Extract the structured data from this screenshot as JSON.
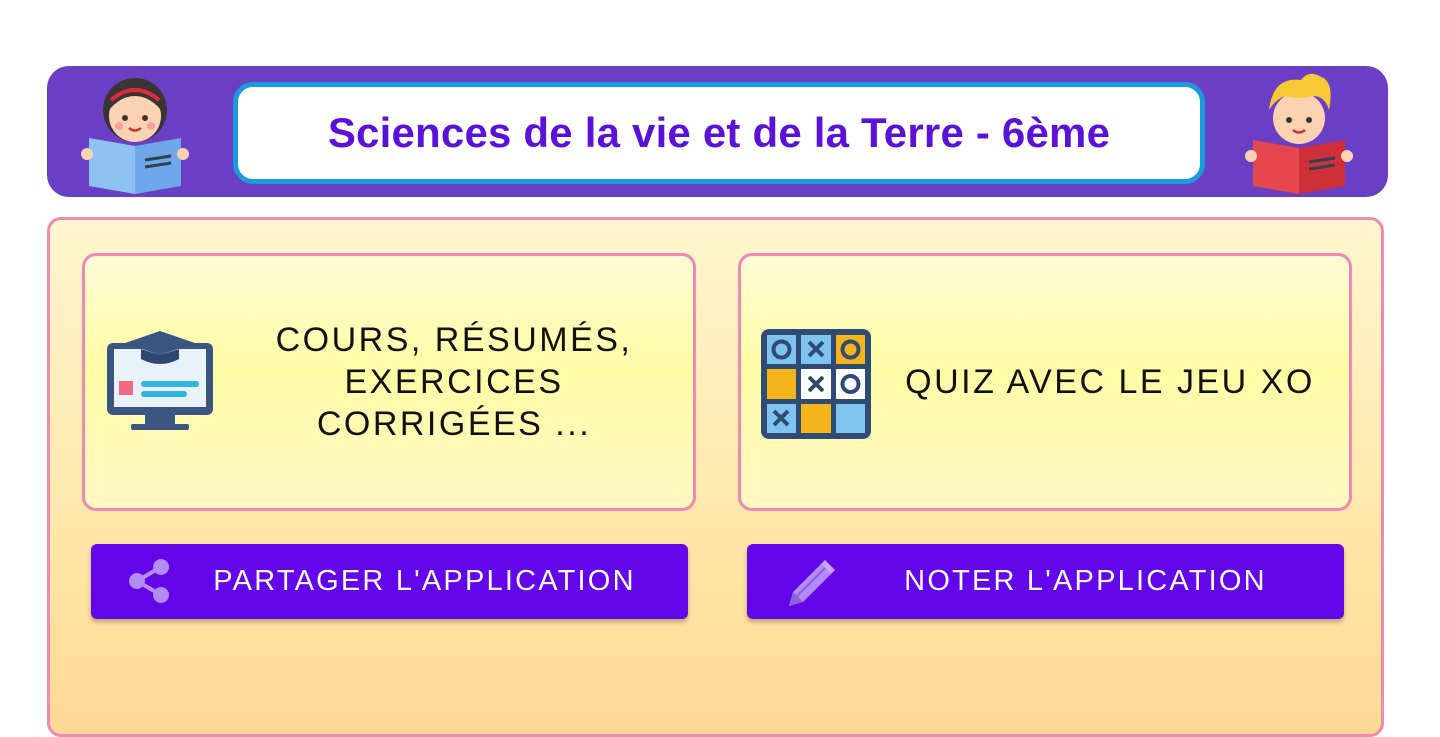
{
  "header": {
    "title": "Sciences de la vie et de la Terre - 6ème"
  },
  "cards": [
    {
      "label": "COURS, RÉSUMÉS, EXERCICES CORRIGÉES ...",
      "icon": "computer-graduation-cap-icon"
    },
    {
      "label": "QUIZ AVEC LE JEU XO",
      "icon": "tic-tac-toe-icon"
    }
  ],
  "buttons": [
    {
      "label": "PARTAGER L'APPLICATION",
      "icon": "share-icon"
    },
    {
      "label": "NOTER L'APPLICATION",
      "icon": "pencil-icon"
    }
  ],
  "colors": {
    "header_bg": "#6b3fc4",
    "title_text": "#5a12d8",
    "title_border": "#1a9bdc",
    "button_bg": "#6205e8",
    "card_border": "#ef8ab3"
  }
}
